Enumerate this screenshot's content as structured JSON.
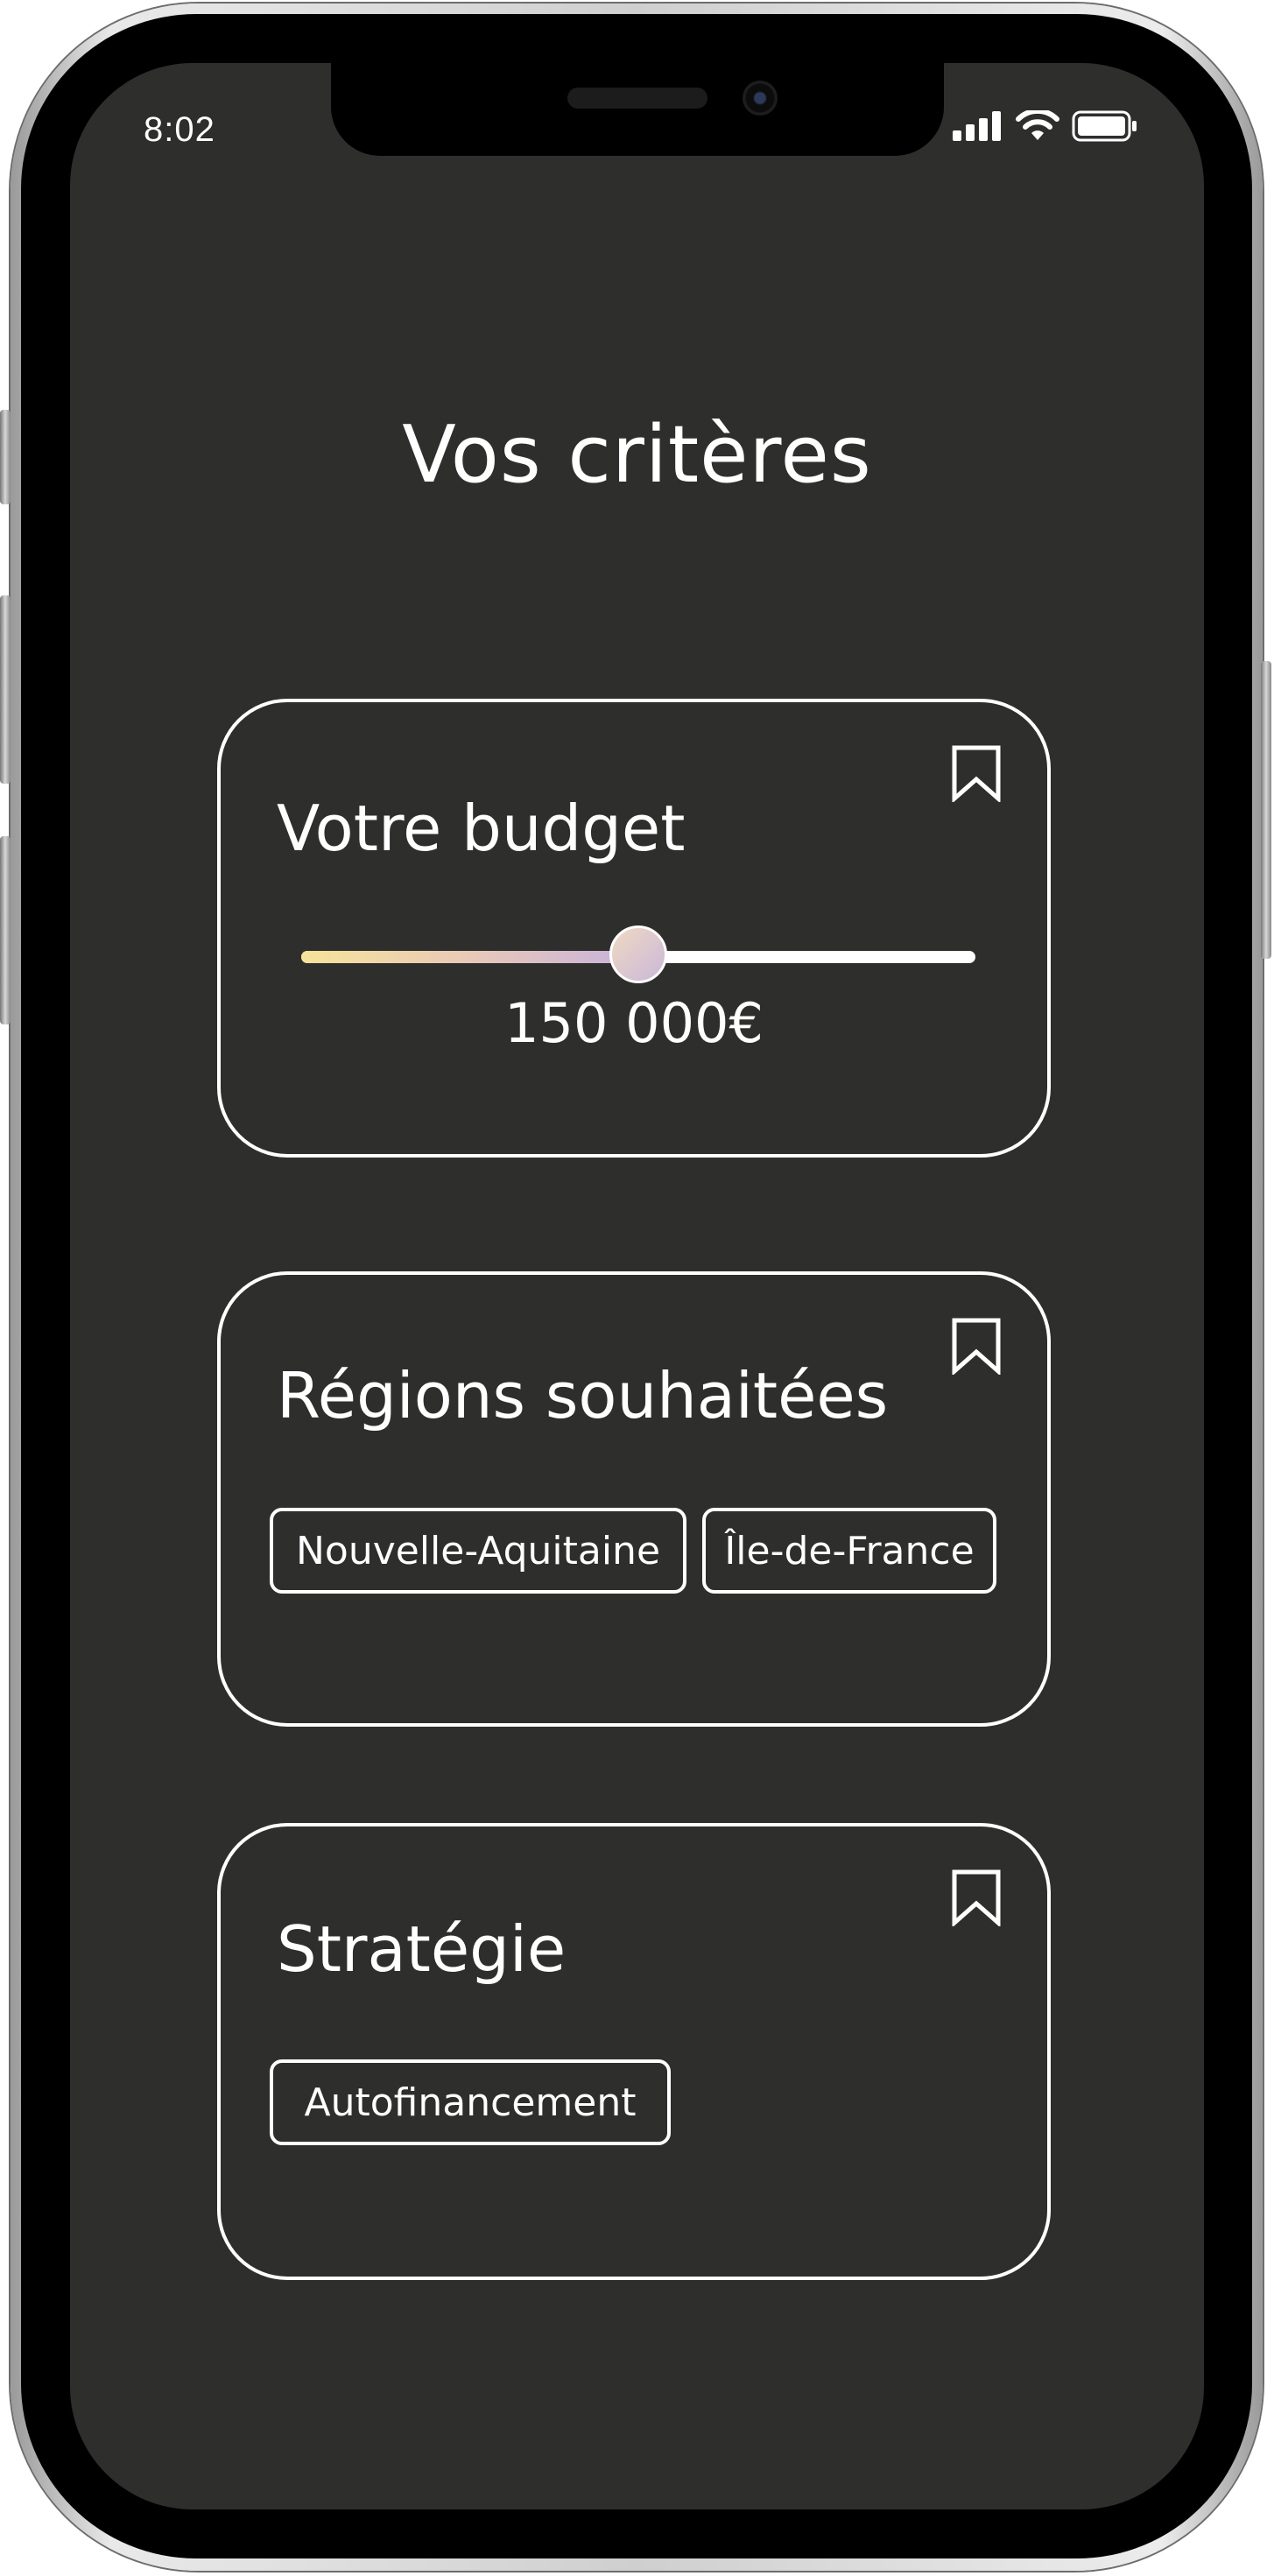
{
  "status_bar": {
    "time": "8:02",
    "icons": [
      "cellular-signal-icon",
      "wifi-icon",
      "battery-icon"
    ]
  },
  "page": {
    "title": "Vos critères"
  },
  "budget_card": {
    "title": "Votre budget",
    "value_label": "150 000€",
    "slider_level": 0.5,
    "icon": "bookmark-icon"
  },
  "regions_card": {
    "title": "Régions souhaitées",
    "chips": [
      "Nouvelle-Aquitaine",
      "Île-de-France"
    ],
    "icon": "bookmark-icon"
  },
  "strategy_card": {
    "title": "Stratégie",
    "chips": [
      "Autofinancement"
    ],
    "icon": "bookmark-icon"
  },
  "colors": {
    "screen_background": "#2e2e2d",
    "foreground": "#ffffff",
    "slider_gradient_start": "#f7e39a",
    "slider_gradient_end": "#c7b2dc"
  }
}
